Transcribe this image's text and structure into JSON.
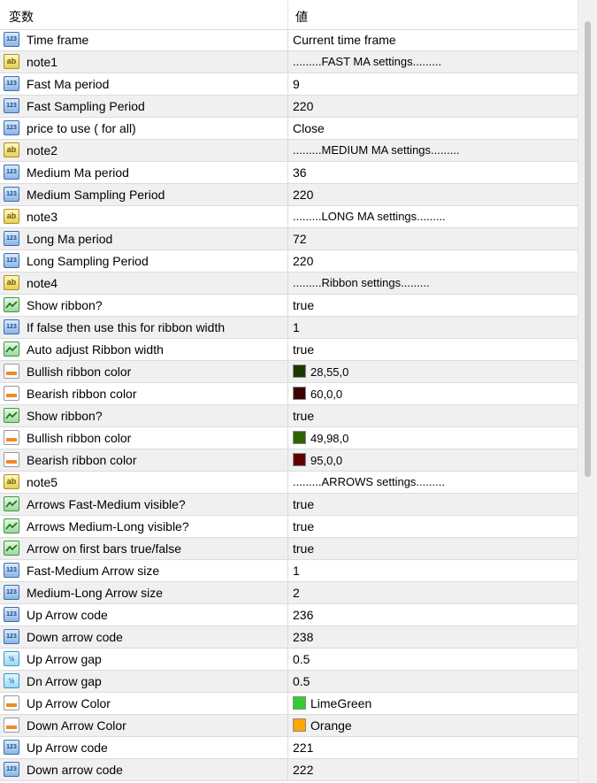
{
  "header": {
    "col_name": "変数",
    "col_value": "値"
  },
  "rows": [
    {
      "type": "int",
      "name": "Time frame",
      "value": "Current time frame"
    },
    {
      "type": "str",
      "name": "note1",
      "value": ".........FAST MA settings........."
    },
    {
      "type": "int",
      "name": "Fast Ma period",
      "value": "9"
    },
    {
      "type": "int",
      "name": "Fast Sampling Period",
      "value": "220"
    },
    {
      "type": "int",
      "name": "price to use ( for all)",
      "value": "Close"
    },
    {
      "type": "str",
      "name": "note2",
      "value": ".........MEDIUM MA settings........."
    },
    {
      "type": "int",
      "name": "Medium Ma period",
      "value": "36"
    },
    {
      "type": "int",
      "name": "Medium Sampling Period",
      "value": "220"
    },
    {
      "type": "str",
      "name": "note3",
      "value": ".........LONG MA settings........."
    },
    {
      "type": "int",
      "name": "Long Ma period",
      "value": "72"
    },
    {
      "type": "int",
      "name": "Long Sampling Period",
      "value": "220"
    },
    {
      "type": "str",
      "name": "note4",
      "value": ".........Ribbon settings........."
    },
    {
      "type": "bool",
      "name": "Show ribbon?",
      "value": "true"
    },
    {
      "type": "int",
      "name": "If  false then use this for ribbon width",
      "value": "1"
    },
    {
      "type": "bool",
      "name": "Auto adjust Ribbon width",
      "value": "true"
    },
    {
      "type": "col",
      "name": "Bullish ribbon  color",
      "value": "28,55,0",
      "color": "#1c3700"
    },
    {
      "type": "col",
      "name": "Bearish ribbon  color",
      "value": "60,0,0",
      "color": "#3c0000"
    },
    {
      "type": "bool",
      "name": "Show ribbon?",
      "value": "true"
    },
    {
      "type": "col",
      "name": "Bullish ribbon  color",
      "value": "49,98,0",
      "color": "#316200"
    },
    {
      "type": "col",
      "name": "Bearish ribbon  color",
      "value": "95,0,0",
      "color": "#5f0000"
    },
    {
      "type": "str",
      "name": "note5",
      "value": ".........ARROWS settings........."
    },
    {
      "type": "bool",
      "name": "Arrows Fast-Medium visible?",
      "value": "true"
    },
    {
      "type": "bool",
      "name": "Arrows Medium-Long visible?",
      "value": "true"
    },
    {
      "type": "bool",
      "name": "Arrow on first bars true/false",
      "value": "true"
    },
    {
      "type": "int",
      "name": "Fast-Medium Arrow size",
      "value": "1"
    },
    {
      "type": "int",
      "name": "Medium-Long Arrow size",
      "value": "2"
    },
    {
      "type": "int",
      "name": "Up Arrow code",
      "value": "236"
    },
    {
      "type": "int",
      "name": "Down arrow code",
      "value": "238"
    },
    {
      "type": "dbl",
      "name": "Up Arrow gap",
      "value": "0.5"
    },
    {
      "type": "dbl",
      "name": "Dn Arrow gap",
      "value": "0.5"
    },
    {
      "type": "col",
      "name": "Up Arrow Color",
      "value": "LimeGreen",
      "color": "#32cd32"
    },
    {
      "type": "col",
      "name": "Down Arrow Color",
      "value": "Orange",
      "color": "#ffa500"
    },
    {
      "type": "int",
      "name": "Up Arrow code",
      "value": "221"
    },
    {
      "type": "int",
      "name": "Down arrow code",
      "value": "222"
    }
  ],
  "icon_glyphs": {
    "int": "123",
    "str": "ab",
    "dbl": "½"
  }
}
